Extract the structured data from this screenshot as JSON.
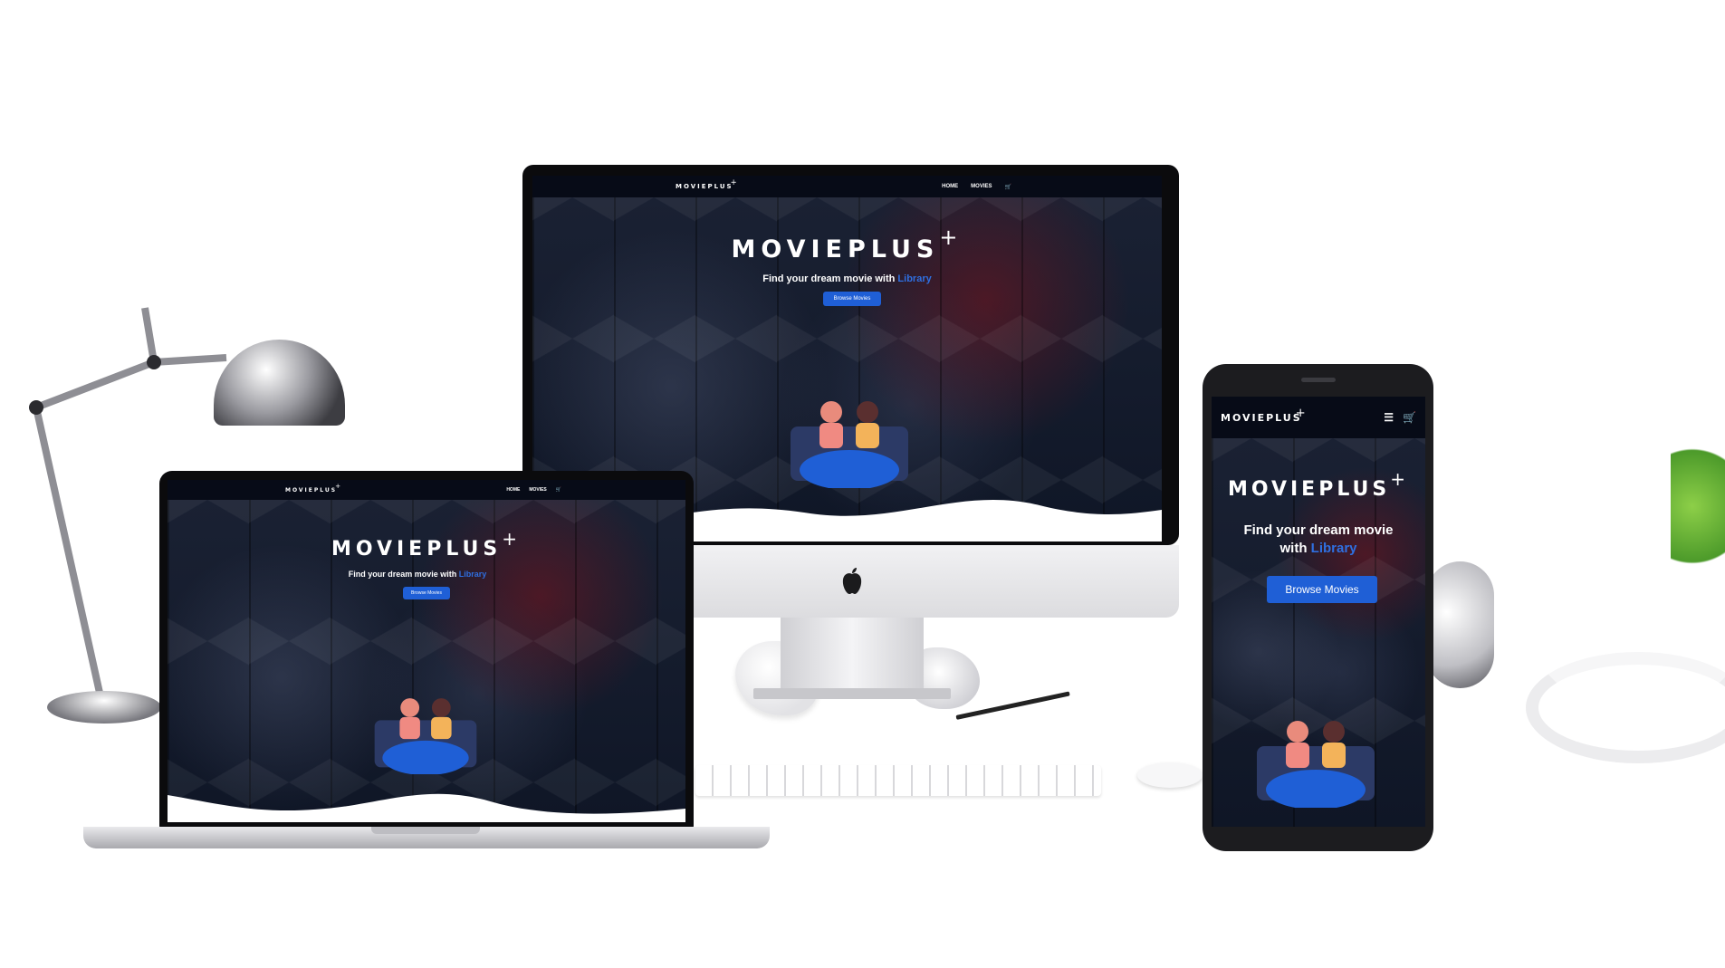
{
  "brand": {
    "name": "MOVIEPLUS",
    "plus": "+"
  },
  "nav": {
    "home": "HOME",
    "movies": "MOVIES",
    "cart_icon": "cart-icon",
    "menu_icon": "hamburger-menu-icon"
  },
  "hero": {
    "tagline_prefix": "Find your dream movie with",
    "tagline_highlight": "Library",
    "tagline_prefix_mobile_line1": "Find your dream movie",
    "tagline_prefix_mobile_line2": "with",
    "cta_label": "Browse Movies"
  },
  "colors": {
    "accent": "#1f5fd6",
    "highlight": "#2f6fe0",
    "nav_bg": "#070b17"
  }
}
